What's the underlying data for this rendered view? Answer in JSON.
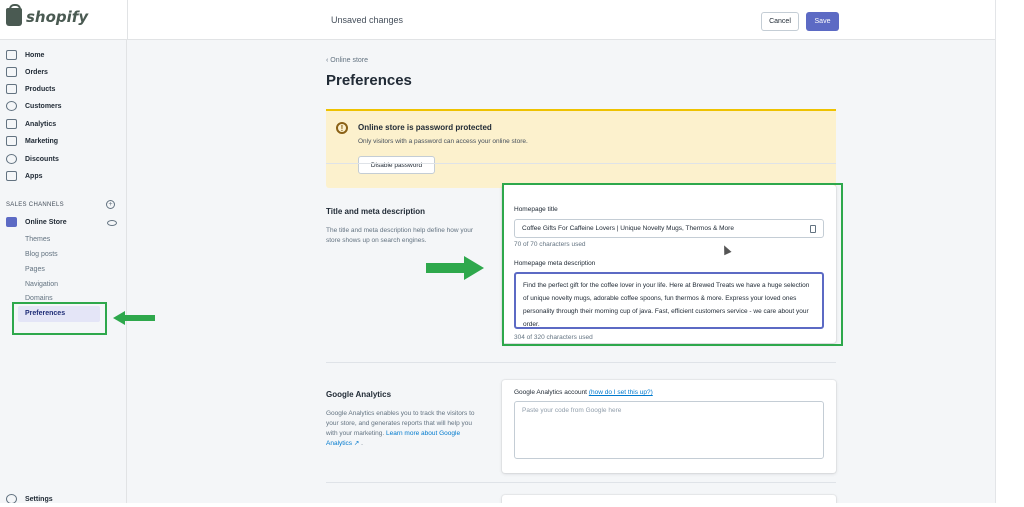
{
  "topbar": {
    "logo_text": "shopify",
    "status": "Unsaved changes",
    "cancel_label": "Cancel",
    "save_label": "Save"
  },
  "sidebar": {
    "items": [
      {
        "label": "Home",
        "icon": "home-icon"
      },
      {
        "label": "Orders",
        "icon": "orders-icon"
      },
      {
        "label": "Products",
        "icon": "tag-icon"
      },
      {
        "label": "Customers",
        "icon": "person-icon"
      },
      {
        "label": "Analytics",
        "icon": "bar-chart-icon"
      },
      {
        "label": "Marketing",
        "icon": "megaphone-icon"
      },
      {
        "label": "Discounts",
        "icon": "discount-icon"
      },
      {
        "label": "Apps",
        "icon": "apps-icon"
      }
    ],
    "channels_header": "SALES CHANNELS",
    "online_store": "Online Store",
    "sub_items": [
      "Themes",
      "Blog posts",
      "Pages",
      "Navigation",
      "Domains",
      "Preferences"
    ],
    "settings": "Settings"
  },
  "main": {
    "breadcrumb": "Online store",
    "title": "Preferences",
    "banner": {
      "title": "Online store is password protected",
      "text": "Only visitors with a password can access your online store.",
      "button": "Disable password"
    },
    "title_meta": {
      "heading": "Title and meta description",
      "description": "The title and meta description help define how your store shows up on search engines.",
      "homepage_title_label": "Homepage title",
      "homepage_title_value": "Coffee Gifts For Caffeine Lovers | Unique Novelty Mugs, Thermos & More",
      "title_counter": "70 of 70 characters used",
      "meta_label": "Homepage meta description",
      "meta_value": "Find the perfect gift for the coffee lover in your life. Here at Brewed Treats we have a huge selection of unique novelty mugs, adorable coffee spoons, fun thermos & more. Express your loved ones personality through their morning cup of java. Fast, efficient customers service - we care about your order.",
      "meta_counter": "304 of 320 characters used"
    },
    "google_analytics": {
      "heading": "Google Analytics",
      "description": "Google Analytics enables you to track the visitors to your store, and generates reports that will help you with your marketing.",
      "learn_more": "Learn more about Google Analytics",
      "account_label": "Google Analytics account",
      "help_link": "(how do I set this up?)",
      "placeholder": "Paste your code from Google here"
    }
  },
  "annotations": {
    "highlight_color": "#2ea84c"
  }
}
